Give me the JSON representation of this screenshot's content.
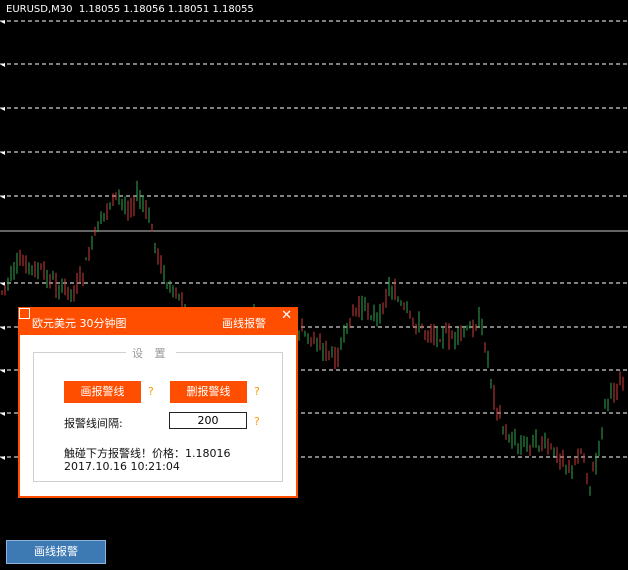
{
  "chart_header": {
    "symbol": "EURUSD,M30",
    "ohlc": "1.18055 1.18056 1.18051 1.18055"
  },
  "colors": {
    "background": "#000000",
    "bull_candle": "#2fa84f",
    "bear_candle": "#d23b3b",
    "alert_line": "#ffffff",
    "panel_accent": "#ff4e00",
    "question_mark": "#ff9a00",
    "bottom_button": "#3d7ab4"
  },
  "alert_panel": {
    "title_left": "欧元美元 30分钟图",
    "title_right": "画线报警",
    "close_glyph": "✕",
    "section_label": "设 置",
    "draw_button": "画报警线",
    "delete_button": "删报警线",
    "help_glyph": "?",
    "interval_label": "报警线间隔:",
    "interval_value": "200",
    "status_message": "触碰下方报警线！价格：1.18016",
    "timestamp": "2017.10.16 10:21:04"
  },
  "bottom_button": {
    "label": "画线报警"
  }
}
